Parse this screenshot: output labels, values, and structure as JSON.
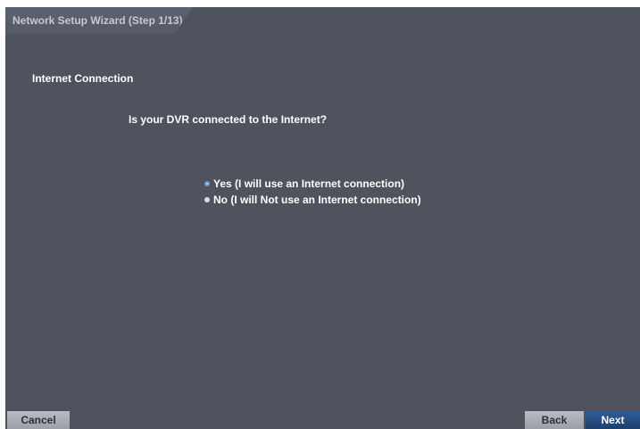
{
  "window": {
    "title": "Network Setup Wizard (Step 1/13)"
  },
  "content": {
    "section_title": "Internet Connection",
    "question": "Is your DVR connected to the Internet?",
    "options": [
      {
        "label": "Yes (I will use an Internet connection)",
        "selected": true
      },
      {
        "label": "No (I will Not use an Internet connection)",
        "selected": false
      }
    ]
  },
  "buttons": {
    "cancel": "Cancel",
    "back": "Back",
    "next": "Next"
  },
  "colors": {
    "background": "#4f535e",
    "accent": "#1c3f6e",
    "selected_radio": "#5b95d8"
  }
}
